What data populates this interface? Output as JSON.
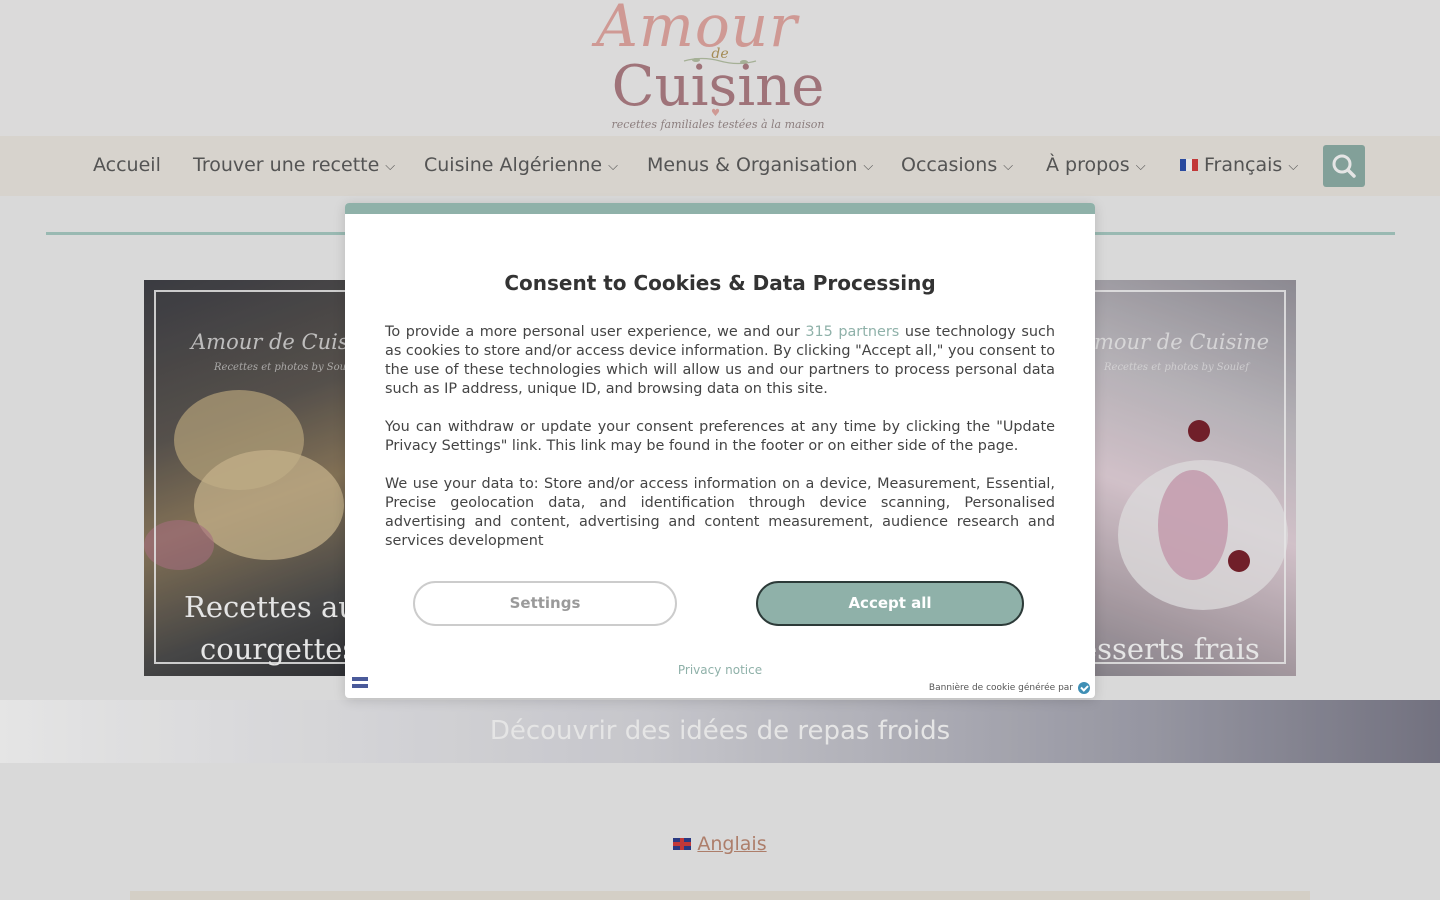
{
  "header": {
    "logo": {
      "script": "Amour",
      "de": "de",
      "name": "Cuisine",
      "tagline": "recettes familiales testées à la maison"
    }
  },
  "nav": {
    "items": [
      {
        "label": "Accueil",
        "has_dropdown": false
      },
      {
        "label": "Trouver une recette",
        "has_dropdown": true
      },
      {
        "label": "Cuisine Algérienne",
        "has_dropdown": true
      },
      {
        "label": "Menus & Organisation",
        "has_dropdown": true
      },
      {
        "label": "Occasions",
        "has_dropdown": true
      },
      {
        "label": "À propos",
        "has_dropdown": true
      }
    ],
    "language": "Français",
    "search_icon": "search-icon",
    "chevron": "⌵"
  },
  "tiles": [
    {
      "caption_line1": "Recettes au",
      "caption_line2": "courgettes",
      "watermark": "Amour de Cuisin",
      "watermark_sub": "Recettes et photos by Soulef"
    },
    {
      "caption_line1": "esserts frais",
      "watermark": "mour de Cuisine",
      "watermark_sub": "Recettes et photos by Soulef"
    }
  ],
  "banner": {
    "label": "Découvrir des idées de repas froids"
  },
  "language_link": {
    "label": "Anglais"
  },
  "consent": {
    "title": "Consent to Cookies & Data Processing",
    "p1_before": "To provide a more personal user experience, we and our ",
    "p1_link": "315 partners",
    "p1_after": " use technology such as cookies to store and/or access device information. By clicking \"Accept all,\" you consent to the use of these technologies which will allow us and our partners to process personal data such as IP address, unique ID, and browsing data on this site.",
    "p2": "You can withdraw or update your consent preferences at any time by clicking the \"Update Privacy Settings\" link. This link may be found in the footer or on either side of the page.",
    "p3": "We use your data to: Store and/or access information on a device, Measurement, Essential, Precise geolocation data, and identification through device scanning, Personalised advertising and content, advertising and content measurement, audience research and services development",
    "settings_label": "Settings",
    "accept_label": "Accept all",
    "privacy_label": "Privacy notice",
    "credit": "Bannière de cookie générée par"
  },
  "colors": {
    "accent": "#8fb1a9",
    "logo_pink": "#e6a9a3",
    "logo_mauve": "#b07e84",
    "link": "#c08a74"
  }
}
